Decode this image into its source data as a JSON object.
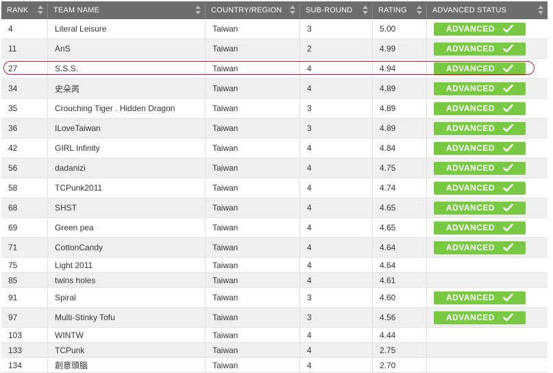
{
  "headers": {
    "rank": "RANK",
    "team": "TEAM NAME",
    "country": "COUNTRY/REGION",
    "subround": "SUB-ROUND",
    "rating": "RATING",
    "status": "ADVANCED STATUS"
  },
  "rows": [
    {
      "rank": "4",
      "team": "Literal Leisure",
      "country": "Taiwan",
      "subround": "3",
      "rating": "5.00",
      "status": "ADVANCED"
    },
    {
      "rank": "11",
      "team": "AnS",
      "country": "Taiwan",
      "subround": "2",
      "rating": "4.99",
      "status": "ADVANCED"
    },
    {
      "rank": "27",
      "team": "S.S.S.",
      "country": "Taiwan",
      "subround": "4",
      "rating": "4.94",
      "status": "ADVANCED"
    },
    {
      "rank": "34",
      "team": "史朵芮",
      "country": "Taiwan",
      "subround": "4",
      "rating": "4.89",
      "status": "ADVANCED"
    },
    {
      "rank": "35",
      "team": "Crouching Tiger . Hidden Dragon",
      "country": "Taiwan",
      "subround": "3",
      "rating": "4.89",
      "status": "ADVANCED"
    },
    {
      "rank": "36",
      "team": "ILoveTaiwan",
      "country": "Taiwan",
      "subround": "3",
      "rating": "4.89",
      "status": "ADVANCED"
    },
    {
      "rank": "42",
      "team": "GIRL Infinity",
      "country": "Taiwan",
      "subround": "4",
      "rating": "4.84",
      "status": "ADVANCED"
    },
    {
      "rank": "56",
      "team": "dadanizi",
      "country": "Taiwan",
      "subround": "4",
      "rating": "4.75",
      "status": "ADVANCED"
    },
    {
      "rank": "58",
      "team": "TCPunk2011",
      "country": "Taiwan",
      "subround": "4",
      "rating": "4.74",
      "status": "ADVANCED"
    },
    {
      "rank": "68",
      "team": "SHST",
      "country": "Taiwan",
      "subround": "4",
      "rating": "4.65",
      "status": "ADVANCED"
    },
    {
      "rank": "69",
      "team": "Green pea",
      "country": "Taiwan",
      "subround": "4",
      "rating": "4.65",
      "status": "ADVANCED"
    },
    {
      "rank": "71",
      "team": "CottonCandy",
      "country": "Taiwan",
      "subround": "4",
      "rating": "4.64",
      "status": "ADVANCED"
    },
    {
      "rank": "75",
      "team": "Light 2011",
      "country": "Taiwan",
      "subround": "4",
      "rating": "4.64",
      "status": ""
    },
    {
      "rank": "85",
      "team": "twins holes",
      "country": "Taiwan",
      "subround": "4",
      "rating": "4.61",
      "status": ""
    },
    {
      "rank": "91",
      "team": "Spiral",
      "country": "Taiwan",
      "subround": "3",
      "rating": "4.60",
      "status": "ADVANCED"
    },
    {
      "rank": "97",
      "team": "Multi-Stinky Tofu",
      "country": "Taiwan",
      "subround": "3",
      "rating": "4.56",
      "status": "ADVANCED"
    },
    {
      "rank": "103",
      "team": "WINTW",
      "country": "Taiwan",
      "subround": "4",
      "rating": "4.44",
      "status": ""
    },
    {
      "rank": "133",
      "team": "TCPunk",
      "country": "Taiwan",
      "subround": "4",
      "rating": "2.75",
      "status": ""
    },
    {
      "rank": "134",
      "team": "創意頭腦",
      "country": "Taiwan",
      "subround": "4",
      "rating": "2.70",
      "status": ""
    }
  ],
  "highlighted_rank": "27",
  "colors": {
    "header_bg": "#6d6d6d",
    "badge": "#7ac943",
    "highlight": "#c8102e"
  },
  "icons": {
    "sort": "sort-arrows-icon",
    "status": "check-icon"
  }
}
